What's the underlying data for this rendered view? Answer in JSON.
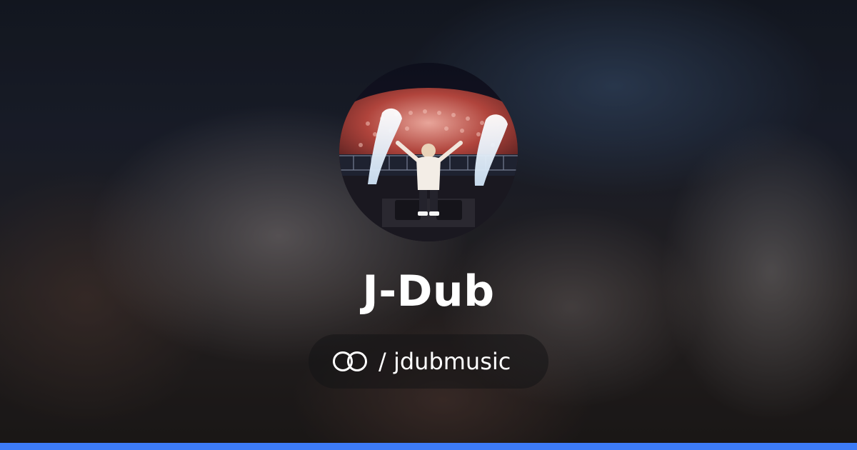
{
  "profile": {
    "name": "J-Dub",
    "handle_text": "/ jdubmusic",
    "avatar_alt": "J-Dub on stage with crowd and CO2 jets"
  },
  "brand": {
    "logo_icon": "linked-rings-icon",
    "accent_color": "#3d7bf7",
    "text_color": "#ffffff"
  }
}
